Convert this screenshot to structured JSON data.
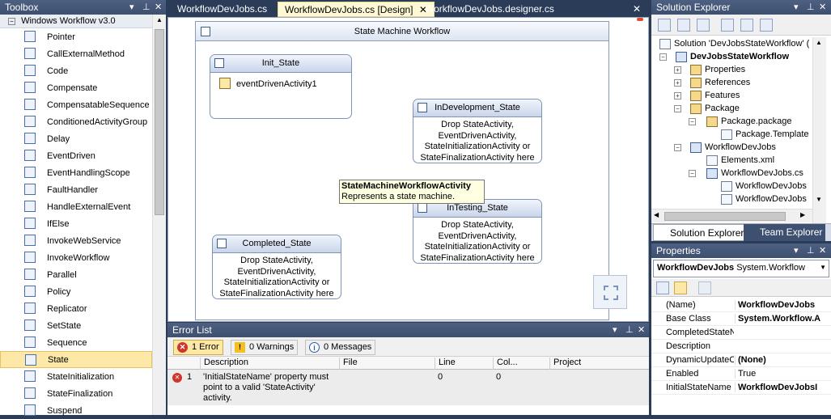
{
  "toolbox": {
    "title": "Toolbox",
    "group": "Windows Workflow v3.0",
    "items": [
      "Pointer",
      "CallExternalMethod",
      "Code",
      "Compensate",
      "CompensatableSequence",
      "ConditionedActivityGroup",
      "Delay",
      "EventDriven",
      "EventHandlingScope",
      "FaultHandler",
      "HandleExternalEvent",
      "IfElse",
      "InvokeWebService",
      "InvokeWorkflow",
      "Parallel",
      "Policy",
      "Replicator",
      "SetState",
      "Sequence",
      "State",
      "StateInitialization",
      "StateFinalization",
      "Suspend"
    ],
    "selected": "State"
  },
  "tabs": [
    {
      "label": "WorkflowDevJobs.cs"
    },
    {
      "label": "WorkflowDevJobs.cs [Design]"
    },
    {
      "label": "WorkflowDevJobs.designer.cs"
    }
  ],
  "designer": {
    "workflow_title": "State Machine Workflow",
    "states": [
      {
        "title": "Init_State",
        "activity": "eventDrivenActivity1"
      },
      {
        "title": "InDevelopment_State",
        "body": "Drop StateActivity, EventDrivenActivity, StateInitializationActivity or StateFinalizationActivity here"
      },
      {
        "title": "InTesting_State",
        "body": "Drop StateActivity, EventDrivenActivity, StateInitializationActivity or StateFinalizationActivity here"
      },
      {
        "title": "Completed_State",
        "body": "Drop StateActivity, EventDrivenActivity, StateInitializationActivity or StateFinalizationActivity here"
      }
    ],
    "tooltip": {
      "title": "StateMachineWorkflowActivity",
      "text": "Represents a state machine."
    }
  },
  "error_list": {
    "title": "Error List",
    "errors_btn": "1 Error",
    "warnings_btn": "0 Warnings",
    "messages_btn": "0 Messages",
    "columns": [
      "Description",
      "File",
      "Line",
      "Col...",
      "Project"
    ],
    "rows": [
      {
        "num": "1",
        "description": "'InitialStateName' property must point to a valid 'StateActivity' activity.",
        "file": "",
        "line": "0",
        "col": "0",
        "project": ""
      }
    ]
  },
  "solution_explorer": {
    "title": "Solution Explorer",
    "items": [
      {
        "label": "Solution 'DevJobsStateWorkflow' (",
        "kind": "solution"
      },
      {
        "label": "DevJobsStateWorkflow",
        "kind": "project"
      },
      {
        "label": "Properties",
        "kind": "folder"
      },
      {
        "label": "References",
        "kind": "folder"
      },
      {
        "label": "Features",
        "kind": "folder"
      },
      {
        "label": "Package",
        "kind": "folder"
      },
      {
        "label": "Package.package",
        "kind": "file"
      },
      {
        "label": "Package.Template",
        "kind": "file"
      },
      {
        "label": "WorkflowDevJobs",
        "kind": "folder"
      },
      {
        "label": "Elements.xml",
        "kind": "file"
      },
      {
        "label": "WorkflowDevJobs.cs",
        "kind": "file"
      },
      {
        "label": "WorkflowDevJobs",
        "kind": "file"
      },
      {
        "label": "WorkflowDevJobs",
        "kind": "file"
      }
    ],
    "tabs": [
      "Solution Explorer",
      "Team Explorer"
    ]
  },
  "properties": {
    "title": "Properties",
    "object_name": "WorkflowDevJobs",
    "object_type": "System.Workflow",
    "rows": [
      {
        "name": "(Name)",
        "value": "WorkflowDevJobs",
        "bold": true
      },
      {
        "name": "Base Class",
        "value": "System.Workflow.A",
        "bold": true
      },
      {
        "name": "CompletedStateN",
        "value": "",
        "bold": false
      },
      {
        "name": "Description",
        "value": "",
        "bold": false
      },
      {
        "name": "DynamicUpdateC",
        "value": "(None)",
        "bold": true
      },
      {
        "name": "Enabled",
        "value": "True",
        "bold": false
      },
      {
        "name": "InitialStateName",
        "value": "WorkflowDevJobsI",
        "bold": true
      }
    ]
  }
}
